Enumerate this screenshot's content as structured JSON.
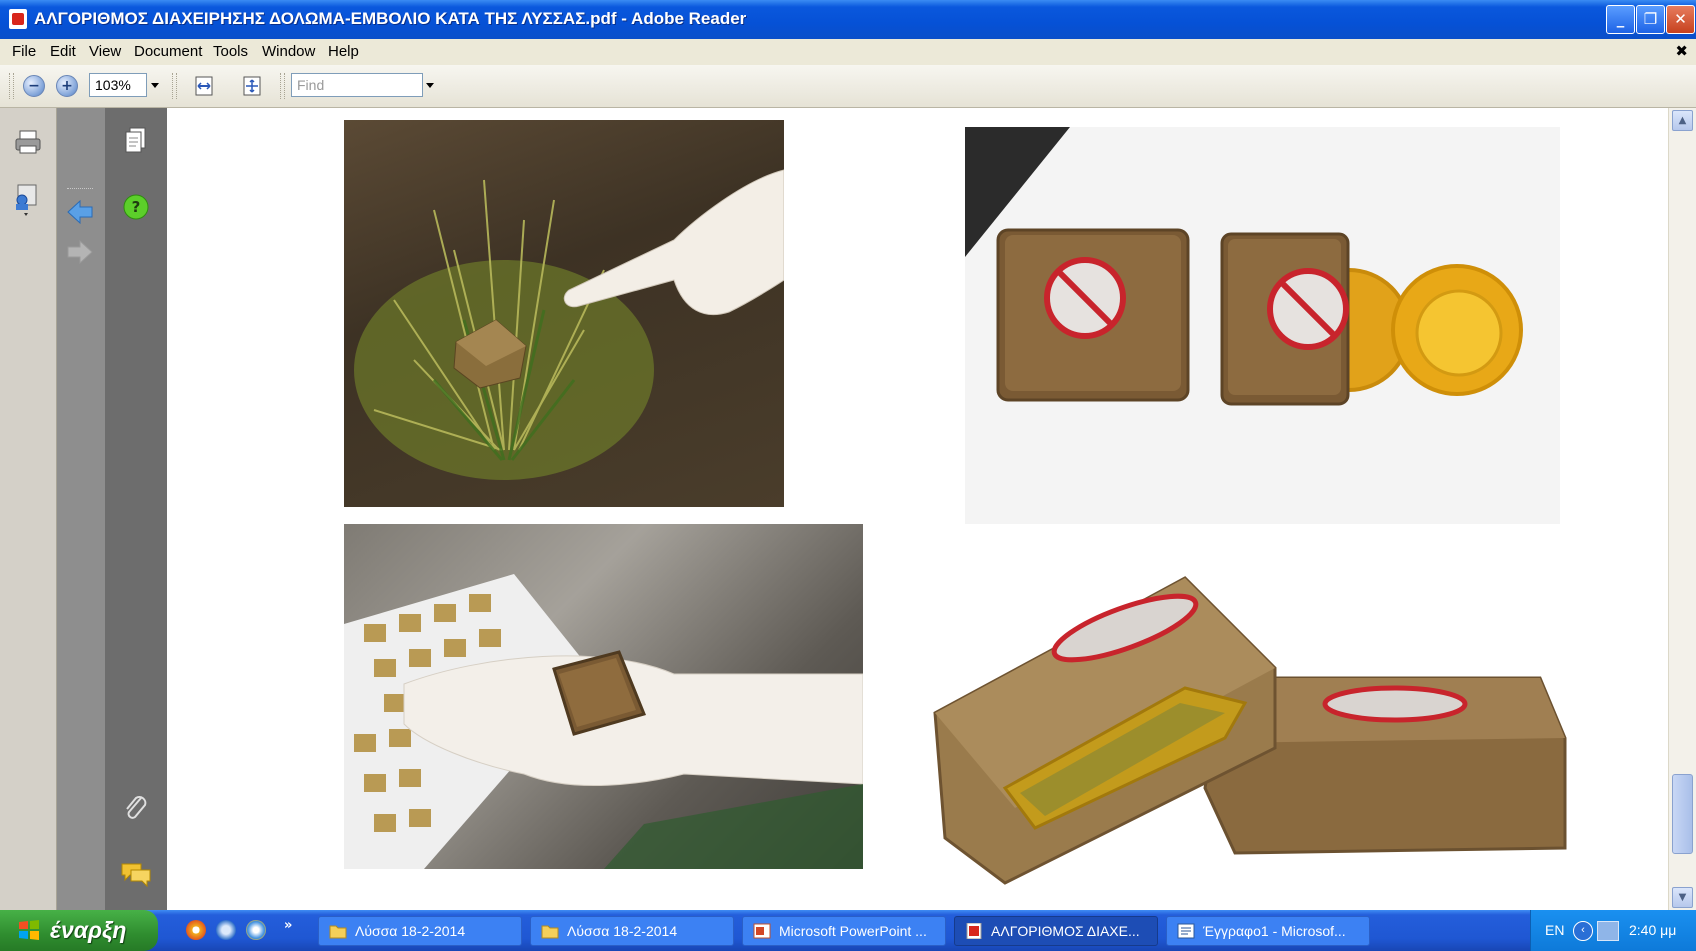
{
  "window": {
    "title": "ΑΛΓΟΡΙΘΜΟΣ ΔΙΑΧΕΙΡΗΣΗΣ ΔΟΛΩΜΑ-ΕΜΒΟΛΙΟ ΚΑΤΑ ΤΗΣ ΛΥΣΣΑΣ.pdf - Adobe Reader",
    "minimize": "_",
    "restore": "❐",
    "close": "✕"
  },
  "menu": {
    "items": [
      "File",
      "Edit",
      "View",
      "Document",
      "Tools",
      "Window",
      "Help"
    ],
    "doc_close": "✖"
  },
  "toolbar": {
    "zoom_value": "103%",
    "find_placeholder": "Find"
  },
  "document": {
    "images": [
      {
        "name": "bait-in-grass-photo",
        "caption": ""
      },
      {
        "name": "bait-blocks-and-capsule-photo",
        "caption": ""
      },
      {
        "name": "bait-on-gloved-hand-photo",
        "caption": ""
      },
      {
        "name": "bait-cut-open-photo",
        "caption": ""
      }
    ]
  },
  "taskbar": {
    "start_label": "έναρξη",
    "items": [
      {
        "label": "Λύσσα 18-2-2014",
        "icon": "folder-icon"
      },
      {
        "label": "Λύσσα 18-2-2014",
        "icon": "folder-icon"
      },
      {
        "label": "Microsoft PowerPoint ...",
        "icon": "powerpoint-icon"
      },
      {
        "label": "ΑΛΓΟΡΙΘΜΟΣ ΔΙΑΧΕ...",
        "icon": "pdf-icon"
      },
      {
        "label": "Έγγραφο1 - Microsof...",
        "icon": "word-icon"
      }
    ],
    "tray_lang": "EN",
    "clock": "2:40 μμ"
  },
  "colors": {
    "title_bar": "#0651d6",
    "taskbar": "#245edb",
    "start_button": "#2f8d2f",
    "left_pane": "#6d6d6d"
  }
}
